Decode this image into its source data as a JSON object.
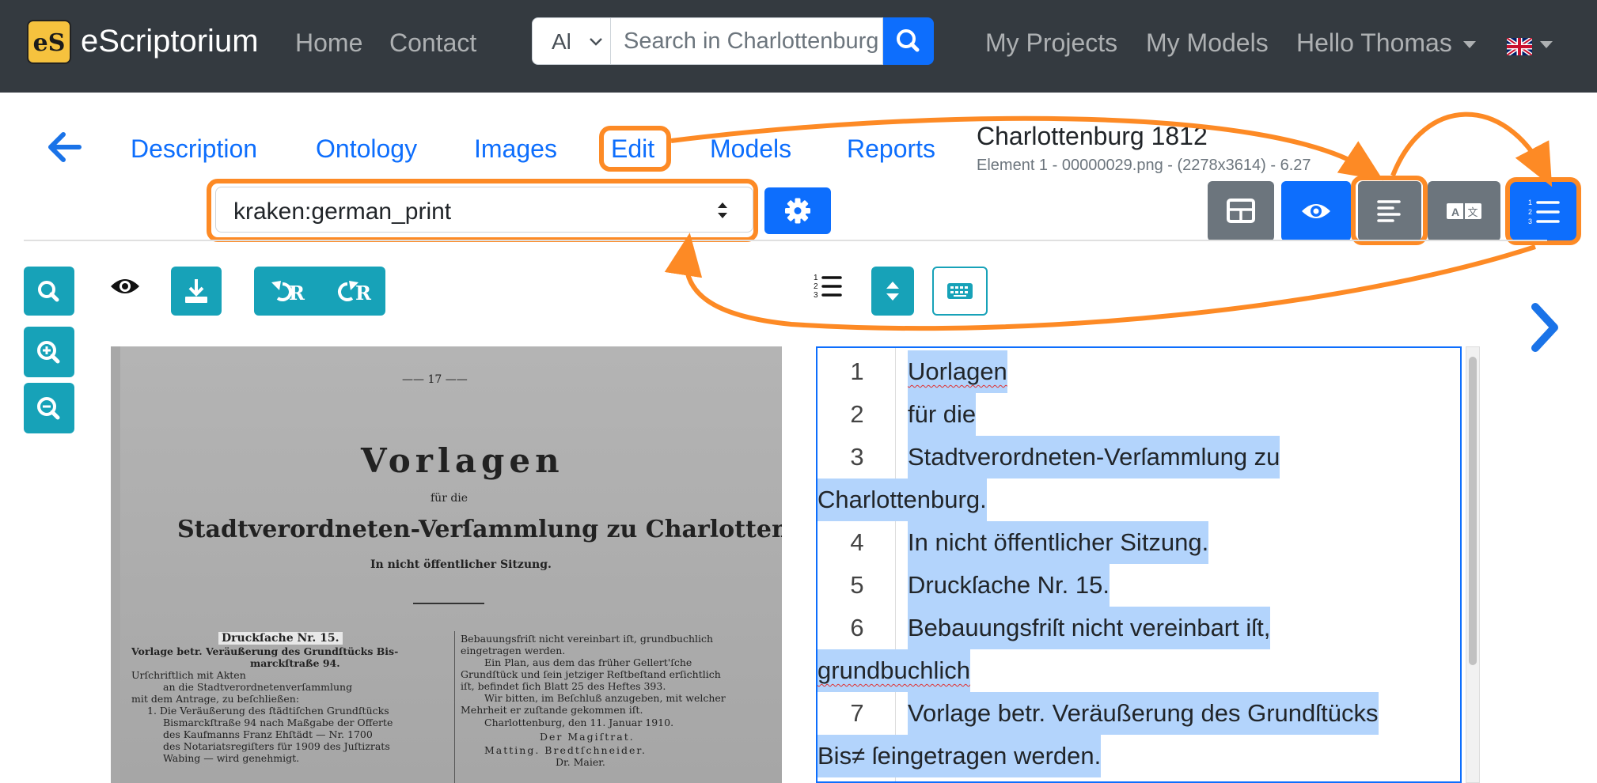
{
  "navbar": {
    "brand": "eScriptorium",
    "logo_text": "eS",
    "links": [
      "Home",
      "Contact"
    ],
    "search_scope": "Al",
    "search_placeholder": "Search in Charlottenburg",
    "right_links": [
      "My Projects",
      "My Models"
    ],
    "user_menu": "Hello Thomas"
  },
  "document": {
    "title": "Charlottenburg 1812",
    "subtitle": "Element 1 - 00000029.png - (2278x3614) - 6.27"
  },
  "tabs": [
    "Description",
    "Ontology",
    "Images",
    "Edit",
    "Models",
    "Reports"
  ],
  "model_select": {
    "value": "kraken:german_print"
  },
  "scan": {
    "page_number": "17",
    "heading": "Vorlagen",
    "fuer_die": "für die",
    "subheading": "Stadtverordneten-Verſammlung zu Charlottenburg.",
    "session": "In nicht öffentlicher Sitzung.",
    "left_col": [
      "Druckſache Nr. 15.",
      "Vorlage betr. Veräußerung des Grundſtücks Bis-",
      "marckſtraße 94.",
      "Urſchriftlich mit Akten",
      "an die Stadtverordnetenverſammlung",
      "mit dem Antrage, zu beſchließen:",
      "1. Die Veräußerung des ſtädtiſchen Grundſtücks",
      "Bismarckſtraße 94 nach Maßgabe der Offerte",
      "des Kaufmanns Franz Ehſtädt — Nr. 1700",
      "des Notariatsregiſters für 1909 des Juſtizrats",
      "Wabing — wird genehmigt."
    ],
    "right_col": [
      "Bebauungsfriſt nicht vereinbart iſt, grundbuchlich",
      "eingetragen werden.",
      "Ein Plan, aus dem das früher Gellert'ſche",
      "Grundſtück und ſein jetziger Reſtbeſtand erſichtlich",
      "iſt, befindet ſich Blatt 25 des Heftes 393.",
      "Wir bitten, im Beſchluß anzugeben, mit welcher",
      "Mehrheit er zuſtande gekommen iſt.",
      "Charlottenburg, den 11. Januar 1910.",
      "Der Magiſtrat.",
      "Matting.   Bredtſchneider.",
      "Dr. Maier."
    ]
  },
  "transcription": [
    {
      "num": "1",
      "text": "Uorlagen",
      "wrap": ""
    },
    {
      "num": "2",
      "text": "für die",
      "wrap": ""
    },
    {
      "num": "3",
      "text": "Stadtverordneten-Verſammlung zu",
      "wrap": "Charlottenburg."
    },
    {
      "num": "4",
      "text": "In nicht öffentlicher Sitzung.",
      "wrap": ""
    },
    {
      "num": "5",
      "text": "Druckſache Nr. 15.",
      "wrap": ""
    },
    {
      "num": "6",
      "text": "Bebauungsfriſt nicht vereinbart iſt,",
      "wrap": "grundbuchlich"
    },
    {
      "num": "7",
      "text": "Vorlage betr. Veräußerung des Grundſtücks",
      "wrap": "Bis≠ ſeingetragen werden."
    }
  ],
  "colors": {
    "primary": "#0d6efd",
    "teal": "#17a2b8",
    "secondary": "#6c757d",
    "navbar": "#343a40",
    "highlight": "#fd8a25",
    "selection": "#b3d4fc"
  },
  "icons": [
    "search-icon",
    "arrow-left-icon",
    "gear-icon",
    "table-icon",
    "eye-icon",
    "align-left-icon",
    "translate-icon",
    "list-ol-icon",
    "zoom-in-icon",
    "zoom-out-icon",
    "download-icon",
    "undo-icon",
    "redo-icon",
    "sort-icon",
    "keyboard-icon",
    "chevron-right-icon"
  ]
}
